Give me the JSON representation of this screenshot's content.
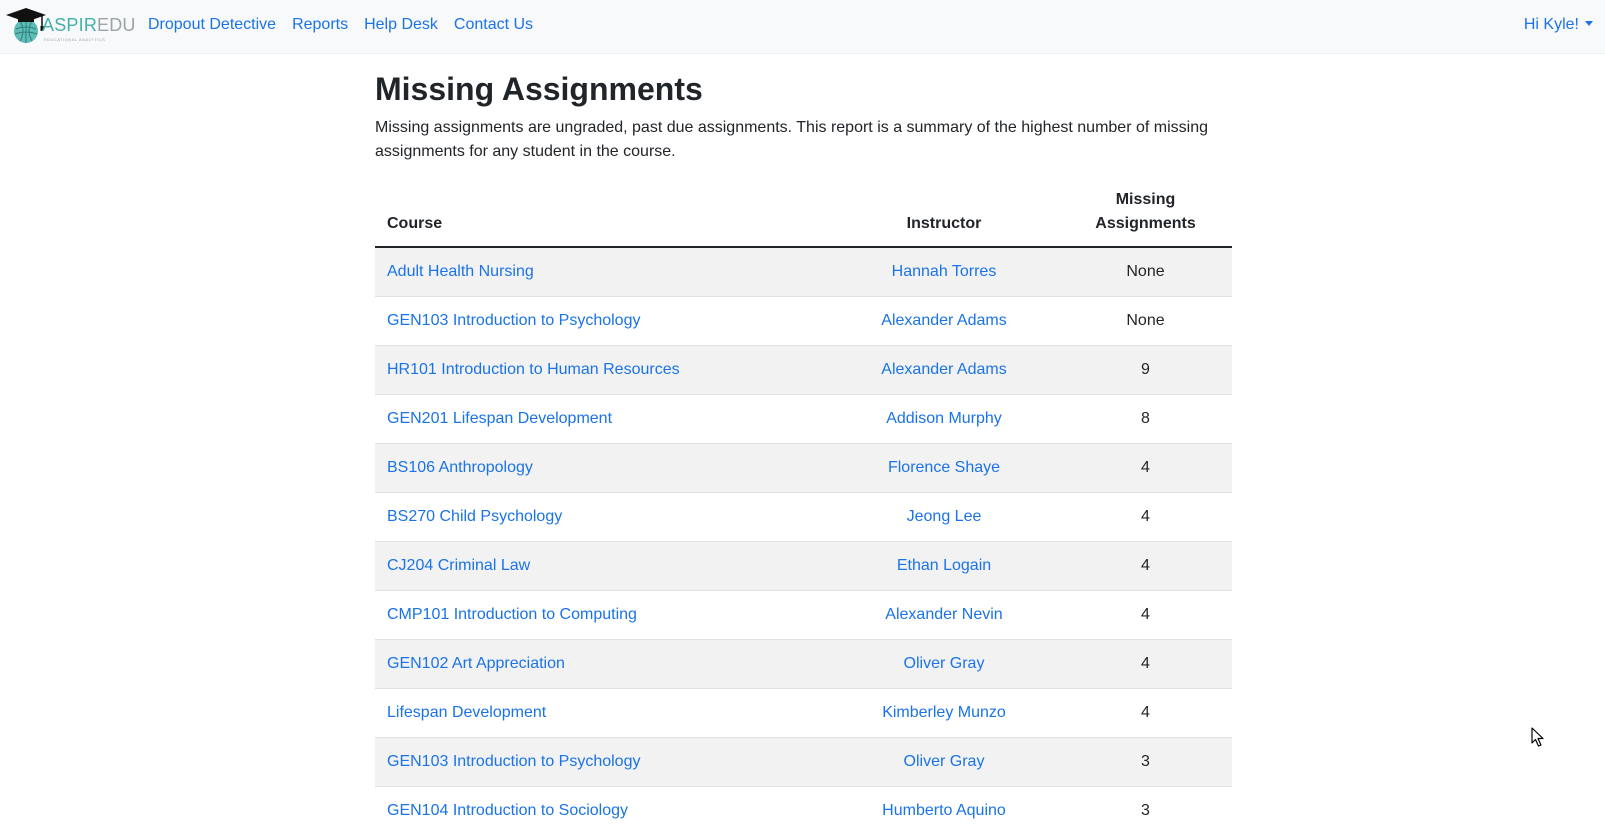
{
  "navbar": {
    "brand_aspire": "ASPIR",
    "brand_edu": "EDU",
    "brand_tagline": "EDUCATIONAL ANALYTICS",
    "links": [
      "Dropout Detective",
      "Reports",
      "Help Desk",
      "Contact Us"
    ],
    "user_greeting": "Hi Kyle!"
  },
  "main": {
    "title": "Missing Assignments",
    "description": "Missing assignments are ungraded, past due assignments. This report is a summary of the highest number of missing assignments for any student in the course.",
    "table": {
      "headers": {
        "course": "Course",
        "instructor": "Instructor",
        "missing_line1": "Missing",
        "missing_line2": "Assignments"
      },
      "rows": [
        {
          "course": "Adult Health Nursing",
          "instructor": "Hannah Torres",
          "missing": "None"
        },
        {
          "course": "GEN103 Introduction to Psychology",
          "instructor": "Alexander Adams",
          "missing": "None"
        },
        {
          "course": "HR101 Introduction to Human Resources",
          "instructor": "Alexander Adams",
          "missing": "9"
        },
        {
          "course": "GEN201 Lifespan Development",
          "instructor": "Addison Murphy",
          "missing": "8"
        },
        {
          "course": "BS106 Anthropology",
          "instructor": "Florence Shaye",
          "missing": "4"
        },
        {
          "course": "BS270 Child Psychology",
          "instructor": "Jeong Lee",
          "missing": "4"
        },
        {
          "course": "CJ204 Criminal Law",
          "instructor": "Ethan Logain",
          "missing": "4"
        },
        {
          "course": "CMP101 Introduction to Computing",
          "instructor": "Alexander Nevin",
          "missing": "4"
        },
        {
          "course": "GEN102 Art Appreciation",
          "instructor": "Oliver Gray",
          "missing": "4"
        },
        {
          "course": "Lifespan Development",
          "instructor": "Kimberley Munzo",
          "missing": "4"
        },
        {
          "course": "GEN103 Introduction to Psychology",
          "instructor": "Oliver Gray",
          "missing": "3"
        },
        {
          "course": "GEN104 Introduction to Sociology",
          "instructor": "Humberto Aquino",
          "missing": "3"
        }
      ]
    }
  },
  "colors": {
    "link": "#1a73e8",
    "brand_teal": "#43b1a9",
    "brand_gray": "#9aa3a8",
    "navbar_bg": "#f8f9fa",
    "stripe": "#f2f2f2"
  },
  "icons": {
    "logo": "graduation-cap-globe-icon",
    "user_menu": "caret-down-icon",
    "pointer": "mouse-cursor-icon"
  }
}
